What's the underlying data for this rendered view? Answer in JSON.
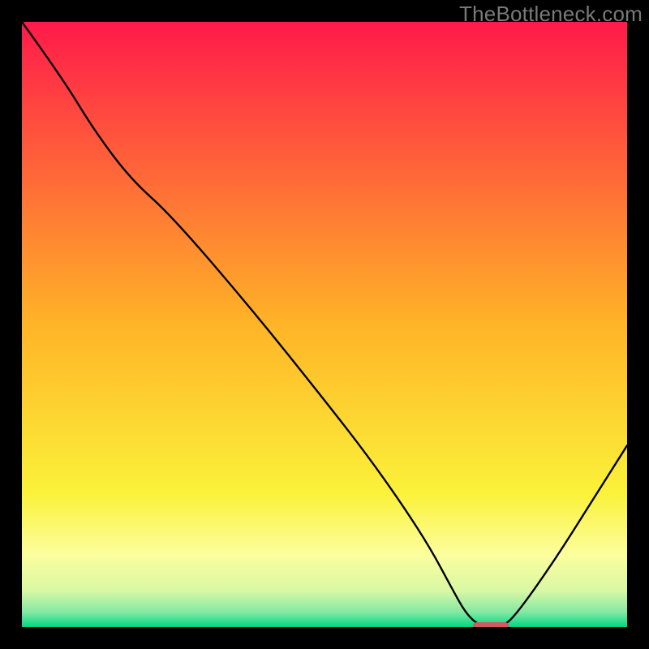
{
  "watermark": "TheBottleneck.com",
  "chart_data": {
    "type": "line",
    "title": "",
    "xlabel": "",
    "ylabel": "",
    "xlim": [
      0,
      100
    ],
    "ylim": [
      0,
      100
    ],
    "background": {
      "type": "vertical-gradient",
      "stops": [
        {
          "pos": 0.0,
          "color": "#ff1a4a"
        },
        {
          "pos": 0.5,
          "color": "#ffb427"
        },
        {
          "pos": 0.78,
          "color": "#fbf23a"
        },
        {
          "pos": 0.88,
          "color": "#fcfe9d"
        },
        {
          "pos": 0.94,
          "color": "#d9f8a4"
        },
        {
          "pos": 0.975,
          "color": "#84e9a3"
        },
        {
          "pos": 1.0,
          "color": "#00d683"
        }
      ]
    },
    "series": [
      {
        "name": "bottleneck-curve",
        "color": "#000000",
        "x": [
          0.0,
          6.5,
          12.0,
          18.0,
          24.7,
          38.0,
          50.0,
          57.0,
          63.0,
          67.5,
          71.0,
          73.5,
          76.0,
          79.5,
          82.0,
          88.0,
          94.0,
          100.0
        ],
        "y": [
          100.0,
          91.0,
          82.0,
          74.0,
          68.0,
          52.5,
          37.5,
          28.5,
          20.0,
          13.0,
          6.5,
          2.0,
          0.0,
          0.0,
          2.5,
          11.0,
          20.5,
          30.0
        ]
      }
    ],
    "marker": {
      "name": "target-marker",
      "color": "#d15a5f",
      "x_center": 77.5,
      "y": 0.0,
      "width_pct": 6.0
    }
  }
}
